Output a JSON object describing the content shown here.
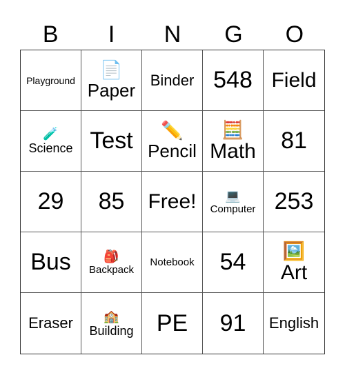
{
  "header": [
    "B",
    "I",
    "N",
    "G",
    "O"
  ],
  "cells": [
    {
      "text": "Playground",
      "icon": ""
    },
    {
      "text": "Paper",
      "icon": "📄"
    },
    {
      "text": "Binder",
      "icon": ""
    },
    {
      "text": "548",
      "icon": ""
    },
    {
      "text": "Field",
      "icon": ""
    },
    {
      "text": "Science",
      "icon": "🧪"
    },
    {
      "text": "Test",
      "icon": ""
    },
    {
      "text": "Pencil",
      "icon": "✏️"
    },
    {
      "text": "Math",
      "icon": "🧮"
    },
    {
      "text": "81",
      "icon": ""
    },
    {
      "text": "29",
      "icon": ""
    },
    {
      "text": "85",
      "icon": ""
    },
    {
      "text": "Free!",
      "icon": ""
    },
    {
      "text": "Computer",
      "icon": "💻"
    },
    {
      "text": "253",
      "icon": ""
    },
    {
      "text": "Bus",
      "icon": ""
    },
    {
      "text": "Backpack",
      "icon": "🎒"
    },
    {
      "text": "Notebook",
      "icon": ""
    },
    {
      "text": "54",
      "icon": ""
    },
    {
      "text": "Art",
      "icon": "🖼️"
    },
    {
      "text": "Eraser",
      "icon": ""
    },
    {
      "text": "Building",
      "icon": "🏫"
    },
    {
      "text": "PE",
      "icon": ""
    },
    {
      "text": "91",
      "icon": ""
    },
    {
      "text": "English",
      "icon": ""
    }
  ]
}
